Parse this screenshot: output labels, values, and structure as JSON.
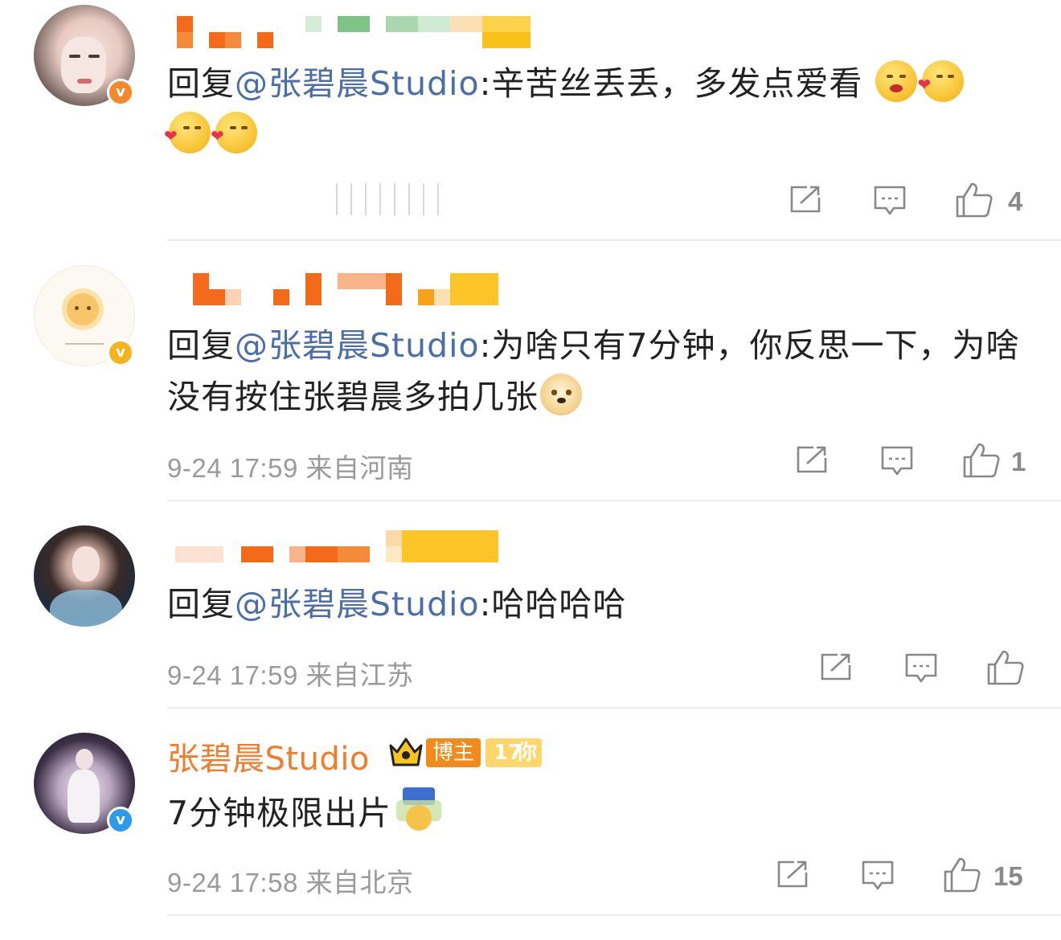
{
  "comments": [
    {
      "reply_prefix": "回复",
      "mention": "@张碧晨Studio",
      "text": ":辛苦丝丢丢，多发点爱看",
      "time": "",
      "likes": "4"
    },
    {
      "reply_prefix": "回复",
      "mention": "@张碧晨Studio",
      "text": ":为啥只有7分钟，你反思一下，为啥没有按住张碧晨多拍几张",
      "time": "9-24 17:59 来自河南",
      "likes": "1"
    },
    {
      "reply_prefix": "回复",
      "mention": "@张碧晨Studio",
      "text": ":哈哈哈哈",
      "time": "9-24 17:59 来自江苏",
      "likes": ""
    },
    {
      "author": "张碧晨Studio",
      "tag_host": "博主",
      "tag_fan_level": "17",
      "tag_fan_label": "你",
      "text": "7分钟极限出片",
      "time": "9-24 17:58 来自北京",
      "likes": "15"
    }
  ],
  "icons": {
    "share": "share-icon",
    "comment": "comment-icon",
    "like": "thumbs-up-icon",
    "verified": "verified-v-icon"
  },
  "colors": {
    "mention": "#4b6ea8",
    "author": "#f27c2b",
    "meta": "#9a9a9a",
    "verified_orange": "#f3892b",
    "verified_gold": "#f6b41c",
    "verified_blue": "#2d9bec"
  }
}
